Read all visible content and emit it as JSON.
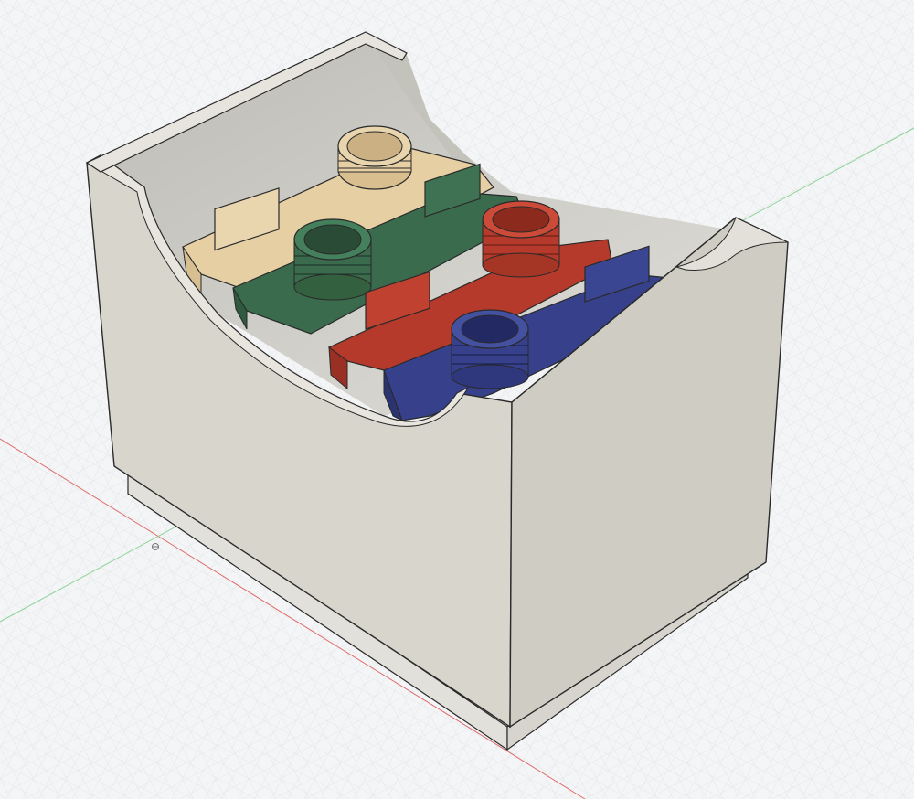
{
  "viewport": {
    "background": "#f4f5f6",
    "grid_minor_color": "#e3e5e8",
    "grid_major_color": "#d2d5da",
    "x_axis_color": "#e06b6b",
    "y_axis_color": "#8fd49a",
    "origin_icon": "origin-marker-icon"
  },
  "model": {
    "box_color": "#d8d6cc",
    "box_side_color": "#cfcdc3",
    "box_inner_color": "#c9c7bf",
    "base_color": "#e2e0da",
    "edge_color": "#2a2a2a",
    "parts": [
      {
        "name": "tan-part",
        "color": "#e6cfa3"
      },
      {
        "name": "green-part",
        "color": "#3a6b4d"
      },
      {
        "name": "red-part",
        "color": "#b63a2b"
      },
      {
        "name": "blue-part",
        "color": "#36408b"
      }
    ]
  }
}
